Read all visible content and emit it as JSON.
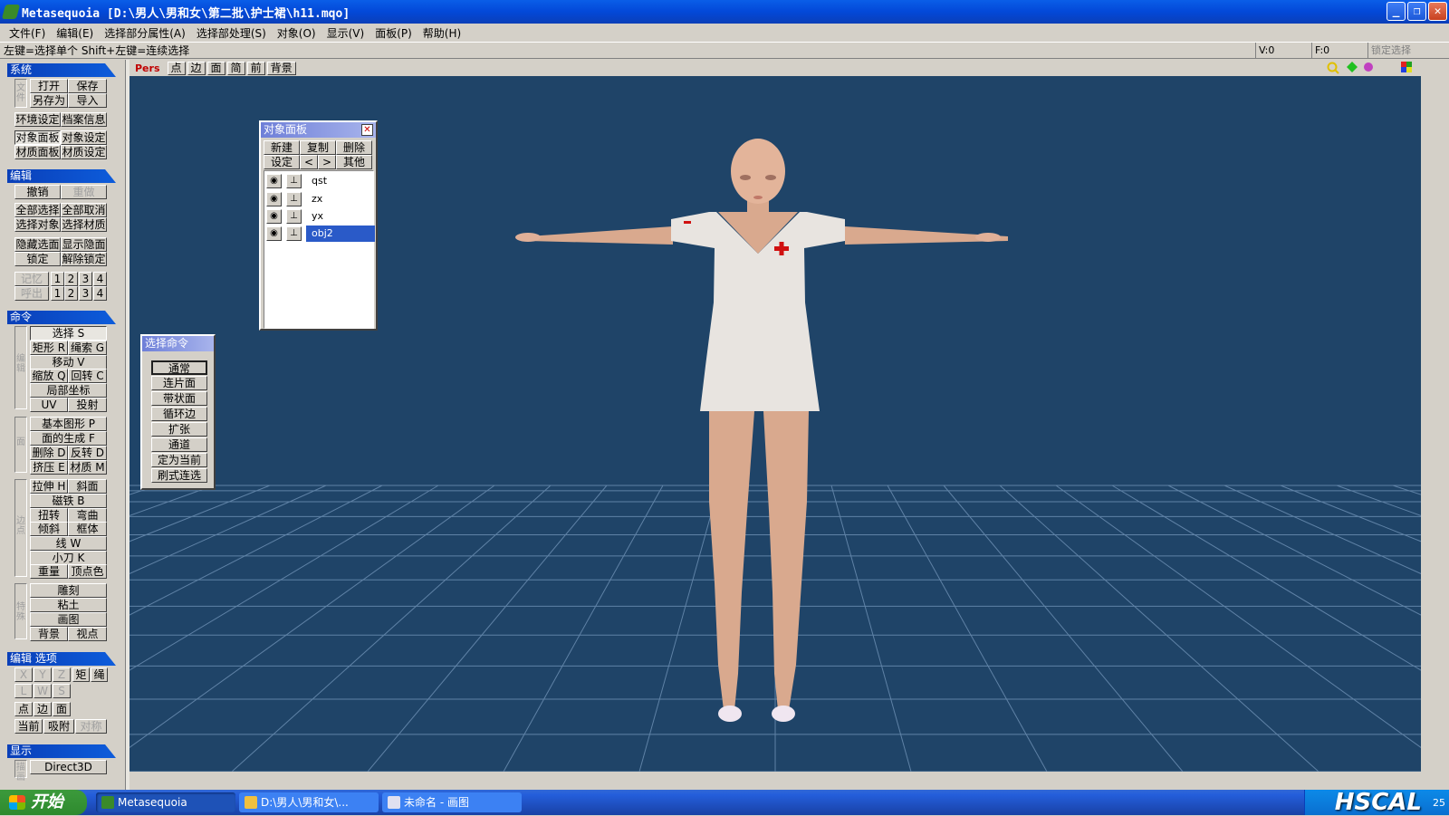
{
  "window": {
    "title": "Metasequoia [D:\\男人\\男和女\\第二批\\护士裙\\h11.mqo]",
    "min": "_",
    "max": "❐",
    "close": "✕"
  },
  "menu": [
    "文件(F)",
    "编辑(E)",
    "选择部分属性(A)",
    "选择部处理(S)",
    "对象(O)",
    "显示(V)",
    "面板(P)",
    "帮助(H)"
  ],
  "status": {
    "hint": "左键=选择单个  Shift+左键=连续选择",
    "v": "V:0",
    "f": "F:0",
    "lock": "锁定选择"
  },
  "viewport_toolbar": {
    "mode": "Pers",
    "buttons": [
      "点",
      "边",
      "面",
      "简",
      "前",
      "背景"
    ]
  },
  "left": {
    "system": {
      "title": "系统",
      "side": "文件",
      "open": "打开",
      "save": "保存",
      "saveas": "另存为",
      "import": "导入",
      "env": "环境设定",
      "info": "档案信息",
      "objpanel": "对象面板",
      "objset": "对象设定",
      "matpanel": "材质面板",
      "matset": "材质设定"
    },
    "edit": {
      "title": "编辑",
      "undo": "撤销",
      "redo": "重做",
      "selall": "全部选择",
      "deselall": "全部取消",
      "selobj": "选择对象",
      "selmat": "选择材质",
      "hidesel": "隐藏选面",
      "showhid": "显示隐面",
      "lock": "锁定",
      "unlock": "解除锁定",
      "mem": "记忆",
      "recall": "呼出",
      "n1": "1",
      "n2": "2",
      "n3": "3",
      "n4": "4"
    },
    "command": {
      "title": "命令",
      "side1": "编辑",
      "select": "选择 S",
      "rect": "矩形 R",
      "lasso": "绳索 G",
      "move": "移动 V",
      "scale": "缩放 Q",
      "rotate": "回转 C",
      "local": "局部坐标",
      "uv": "UV",
      "proj": "投射",
      "side2": "面",
      "prim": "基本图形 P",
      "facegen": "面的生成 F",
      "del": "删除 D",
      "flip": "反转 D",
      "extrude": "挤压 E",
      "mat": "材质 M",
      "side3": "边点",
      "stretch": "拉伸 H",
      "bevel": "斜面",
      "magnet": "磁铁 B",
      "twist": "扭转",
      "bend": "弯曲",
      "tilt": "倾斜",
      "frame": "框体",
      "line": "线 W",
      "knife": "小刀 K",
      "weight": "重量",
      "vcolor": "顶点色",
      "side4": "特殊",
      "sculpt": "雕刻",
      "clay": "粘土",
      "paint": "画图",
      "bg": "背景",
      "view": "视点"
    },
    "editopt": {
      "title": "编辑 选项",
      "x": "X",
      "y": "Y",
      "z": "Z",
      "rectsel": "矩",
      "ropesel": "绳",
      "l": "L",
      "w": "W",
      "s": "S",
      "pt": "点",
      "ed": "边",
      "fc": "面",
      "cur": "当前",
      "snap": "吸附",
      "sym": "对称"
    },
    "display": {
      "title": "显示",
      "side": "描画",
      "mode": "Direct3D"
    }
  },
  "object_panel": {
    "title": "对象面板",
    "new": "新建",
    "copy": "复制",
    "del": "删除",
    "set": "设定",
    "prev": "<",
    "next": ">",
    "other": "其他",
    "objects": [
      {
        "name": "qst",
        "selected": false
      },
      {
        "name": "zx",
        "selected": false
      },
      {
        "name": "yx",
        "selected": false
      },
      {
        "name": "obj2",
        "selected": true
      }
    ]
  },
  "select_panel": {
    "title": "选择命令",
    "items": [
      "通常",
      "连片面",
      "带状面",
      "循环边",
      "扩张",
      "通道",
      "定为当前",
      "刷式连选"
    ],
    "active_index": 0
  },
  "taskbar": {
    "start": "开始",
    "tasks": [
      "Metasequoia",
      "D:\\男人\\男和女\\...",
      "未命名 - 画图"
    ],
    "watermark": "HSCAL",
    "clock": "25"
  },
  "colors": {
    "viewport": "#1f4468",
    "grid": "#6a8aa8",
    "title": "#0348d8",
    "selected": "#2a5ac8"
  }
}
